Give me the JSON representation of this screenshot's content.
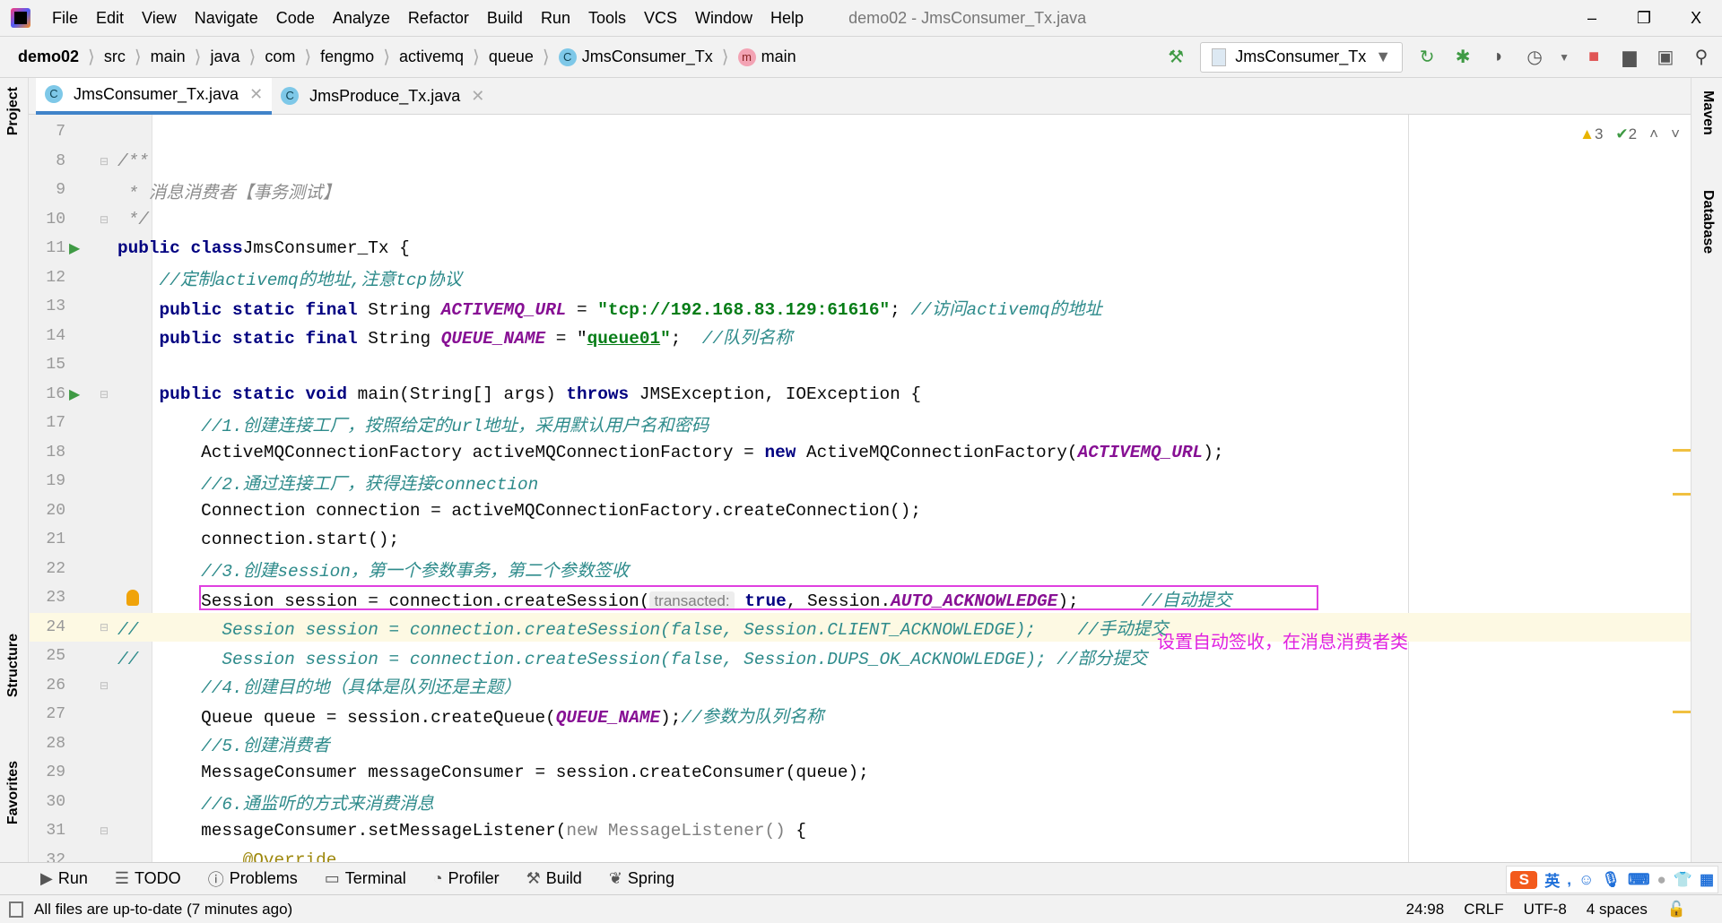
{
  "menubar": {
    "items": [
      "File",
      "Edit",
      "View",
      "Navigate",
      "Code",
      "Analyze",
      "Refactor",
      "Build",
      "Run",
      "Tools",
      "VCS",
      "Window",
      "Help"
    ],
    "title": "demo02 - JmsConsumer_Tx.java",
    "minimize": "–",
    "restore": "❐",
    "close": "X"
  },
  "breadcrumb": [
    "demo02",
    "src",
    "main",
    "java",
    "com",
    "fengmo",
    "activemq",
    "queue",
    "JmsConsumer_Tx",
    "main"
  ],
  "toolbar": {
    "run_config": "JmsConsumer_Tx"
  },
  "tabs": [
    {
      "label": "JmsConsumer_Tx.java",
      "active": true
    },
    {
      "label": "JmsProduce_Tx.java",
      "active": false
    }
  ],
  "side": {
    "project": "Project",
    "structure": "Structure",
    "favorites": "Favorites",
    "maven": "Maven",
    "database": "Database"
  },
  "inspections": {
    "warnings": "3",
    "weak_warnings": "2"
  },
  "annotation": "设置自动签收，在消息消费者类",
  "code": {
    "current_line": 24,
    "lines": [
      {
        "n": "7",
        "t": []
      },
      {
        "n": "8",
        "t": [
          [
            "doc",
            "/**"
          ]
        ],
        "fold": true
      },
      {
        "n": "9",
        "t": [
          [
            "doc",
            " * 消息消费者【事务测试】"
          ]
        ]
      },
      {
        "n": "10",
        "t": [
          [
            "doc",
            " */"
          ]
        ],
        "fold": true
      },
      {
        "n": "11",
        "t": [
          [
            "kw",
            "public class"
          ],
          [
            "",
            "JmsConsumer_Tx {"
          ]
        ],
        "run": true
      },
      {
        "n": "12",
        "t": [
          [
            "",
            "    "
          ],
          [
            "cm",
            "//定制activemq的地址,注意tcp协议"
          ]
        ]
      },
      {
        "n": "13",
        "t": [
          [
            "",
            "    "
          ],
          [
            "kw",
            "public static final"
          ],
          [
            "",
            " String "
          ],
          [
            "sf",
            "ACTIVEMQ_URL"
          ],
          [
            "",
            " = "
          ],
          [
            "str",
            "\"tcp://192.168.83.129:61616\""
          ],
          [
            "",
            "; "
          ],
          [
            "cm",
            "//访问activemq的地址"
          ]
        ]
      },
      {
        "n": "14",
        "t": [
          [
            "",
            "    "
          ],
          [
            "kw",
            "public static final"
          ],
          [
            "",
            " String "
          ],
          [
            "sf",
            "QUEUE_NAME"
          ],
          [
            "",
            " = \""
          ],
          [
            "strul",
            "queue01"
          ],
          [
            "str",
            "\""
          ],
          [
            "",
            ";  "
          ],
          [
            "cm",
            "//队列名称"
          ]
        ]
      },
      {
        "n": "15",
        "t": []
      },
      {
        "n": "16",
        "t": [
          [
            "",
            "    "
          ],
          [
            "kw",
            "public static void"
          ],
          [
            "",
            " main(String[] args) "
          ],
          [
            "kw",
            "throws"
          ],
          [
            "",
            " JMSException, IOException {"
          ]
        ],
        "run": true,
        "fold": true
      },
      {
        "n": "17",
        "t": [
          [
            "",
            "        "
          ],
          [
            "cm",
            "//1.创建连接工厂，按照给定的url地址，采用默认用户名和密码"
          ]
        ]
      },
      {
        "n": "18",
        "t": [
          [
            "",
            "        ActiveMQConnectionFactory activeMQConnectionFactory = "
          ],
          [
            "kw",
            "new"
          ],
          [
            "",
            " ActiveMQConnectionFactory("
          ],
          [
            "sf",
            "ACTIVEMQ_URL"
          ],
          [
            "",
            ");"
          ]
        ]
      },
      {
        "n": "19",
        "t": [
          [
            "",
            "        "
          ],
          [
            "cm",
            "//2.通过连接工厂，获得连接connection"
          ]
        ]
      },
      {
        "n": "20",
        "t": [
          [
            "",
            "        Connection connection = activeMQConnectionFactory.createConnection();"
          ]
        ]
      },
      {
        "n": "21",
        "t": [
          [
            "",
            "        connection.start();"
          ]
        ]
      },
      {
        "n": "22",
        "t": [
          [
            "",
            "        "
          ],
          [
            "cm",
            "//3.创建session，第一个参数事务，第二个参数签收"
          ]
        ]
      },
      {
        "n": "23",
        "t": [
          [
            "",
            "        Session session = connection.createSession("
          ],
          [
            "hint",
            "transacted:"
          ],
          [
            "",
            " "
          ],
          [
            "kw",
            "true"
          ],
          [
            "",
            ", Session."
          ],
          [
            "sf",
            "AUTO_ACKNOWLEDGE"
          ],
          [
            "",
            ");      "
          ],
          [
            "cm",
            "//自动提交"
          ]
        ],
        "bulb": true
      },
      {
        "n": "24",
        "t": [
          [
            "cm",
            "//        Session session = connection.createSession(false, Session.CLIENT_ACKNOWLEDGE);    //手动提交"
          ]
        ],
        "fold": true
      },
      {
        "n": "25",
        "t": [
          [
            "cm",
            "//        Session session = connection.createSession(false, Session.DUPS_OK_ACKNOWLEDGE); //部分提交"
          ]
        ]
      },
      {
        "n": "26",
        "t": [
          [
            "",
            "        "
          ],
          [
            "cm",
            "//4.创建目的地（具体是队列还是主题）"
          ]
        ],
        "fold": true
      },
      {
        "n": "27",
        "t": [
          [
            "",
            "        Queue queue = session.createQueue("
          ],
          [
            "sf",
            "QUEUE_NAME"
          ],
          [
            "",
            ");"
          ],
          [
            "cm",
            "//参数为队列名称"
          ]
        ]
      },
      {
        "n": "28",
        "t": [
          [
            "",
            "        "
          ],
          [
            "cm",
            "//5.创建消费者"
          ]
        ]
      },
      {
        "n": "29",
        "t": [
          [
            "",
            "        MessageConsumer messageConsumer = session.createConsumer(queue);"
          ]
        ]
      },
      {
        "n": "30",
        "t": [
          [
            "",
            "        "
          ],
          [
            "cm",
            "//6.通监听的方式来消费消息"
          ]
        ]
      },
      {
        "n": "31",
        "t": [
          [
            "",
            "        messageConsumer.setMessageListener("
          ],
          [
            "gray",
            "new MessageListener()"
          ],
          [
            "",
            " {"
          ]
        ],
        "fold": true
      },
      {
        "n": "32",
        "t": [
          [
            "",
            "            "
          ],
          [
            "ann",
            "@Override"
          ]
        ]
      }
    ]
  },
  "toolwindows": [
    "Run",
    "TODO",
    "Problems",
    "Terminal",
    "Profiler",
    "Build",
    "Spring"
  ],
  "ime": {
    "lang": "英"
  },
  "status": {
    "message": "All files are up-to-date (7 minutes ago)",
    "position": "24:98",
    "line_sep": "CRLF",
    "encoding": "UTF-8",
    "indent": "4 spaces"
  }
}
